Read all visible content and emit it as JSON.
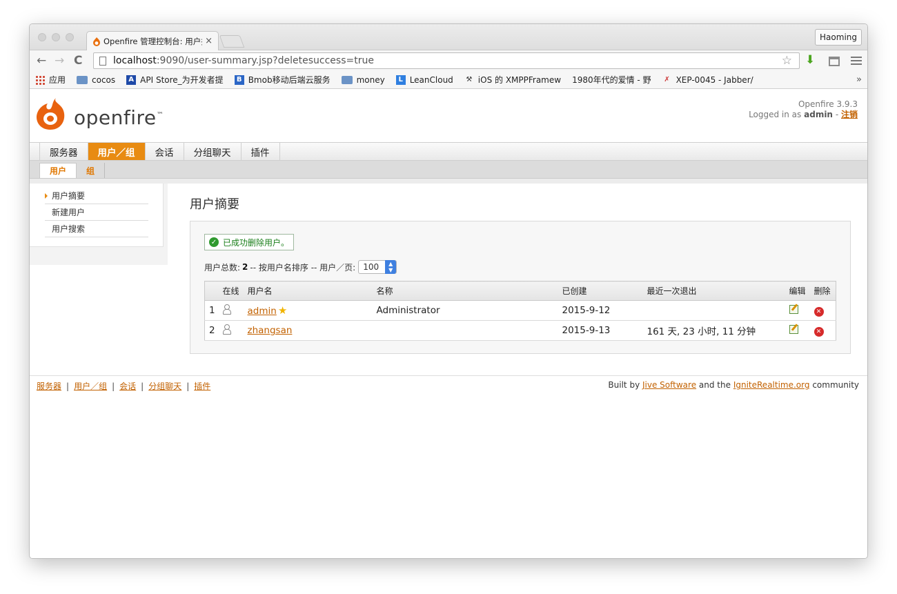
{
  "browser": {
    "tab_title": "Openfire 管理控制台: 用户摘",
    "tab_close": "×",
    "profile": "Haoming",
    "url_host": "localhost",
    "url_rest": ":9090/user-summary.jsp?deletesuccess=true",
    "bookmarks": [
      {
        "label": "应用",
        "icon": "apps-grid-icon"
      },
      {
        "label": "cocos",
        "icon": "folder-icon"
      },
      {
        "label": "API Store_为开发者提",
        "icon": "api-store-icon",
        "glyph": "A"
      },
      {
        "label": "Bmob移动后端云服务",
        "icon": "bmob-icon",
        "glyph": "B"
      },
      {
        "label": "money",
        "icon": "folder-icon"
      },
      {
        "label": "LeanCloud",
        "icon": "leancloud-icon",
        "glyph": "L"
      },
      {
        "label": "iOS 的 XMPPFramew",
        "icon": "github-icon"
      },
      {
        "label": "1980年代的爱情 - 野",
        "icon": "page-icon"
      },
      {
        "label": "XEP-0045 - Jabber/",
        "icon": "xmpp-icon"
      }
    ],
    "overflow": "»"
  },
  "header": {
    "logo_text": "openfire",
    "version": "Openfire 3.9.3",
    "logged_in_prefix": "Logged in as",
    "user": "admin",
    "separator": "-",
    "logout": "注销"
  },
  "main_nav": [
    "服务器",
    "用户／组",
    "会话",
    "分组聊天",
    "插件"
  ],
  "sub_nav": [
    "用户",
    "组"
  ],
  "sidebar": [
    "用户摘要",
    "新建用户",
    "用户搜索"
  ],
  "content": {
    "title": "用户摘要",
    "success_message": "已成功删除用户。",
    "summary_prefix": "用户总数:",
    "total": "2",
    "summary_suffix": "-- 按用户名排序 -- 用户／页:",
    "per_page": "100",
    "table": {
      "headers": [
        "",
        "在线",
        "用户名",
        "名称",
        "已创建",
        "最近一次退出",
        "编辑",
        "删除"
      ],
      "rows": [
        {
          "index": "1",
          "username": "admin",
          "name": "Administrator",
          "created": "2015-9-12",
          "last_logout": "",
          "is_admin": true
        },
        {
          "index": "2",
          "username": "zhangsan",
          "name": "",
          "created": "2015-9-13",
          "last_logout": "161 天, 23 小时, 11 分钟",
          "is_admin": false
        }
      ]
    }
  },
  "footer": {
    "links": [
      "服务器",
      "用户／组",
      "会话",
      "分组聊天",
      "插件"
    ],
    "built_by": "Built by",
    "jive": "Jive Software",
    "and_the": "and the",
    "ignite": "IgniteRealtime.org",
    "community": "community"
  },
  "colors": {
    "accent": "#e88b12",
    "link": "#c26100",
    "success": "#2f9a2f",
    "delete": "#d62b2b"
  }
}
